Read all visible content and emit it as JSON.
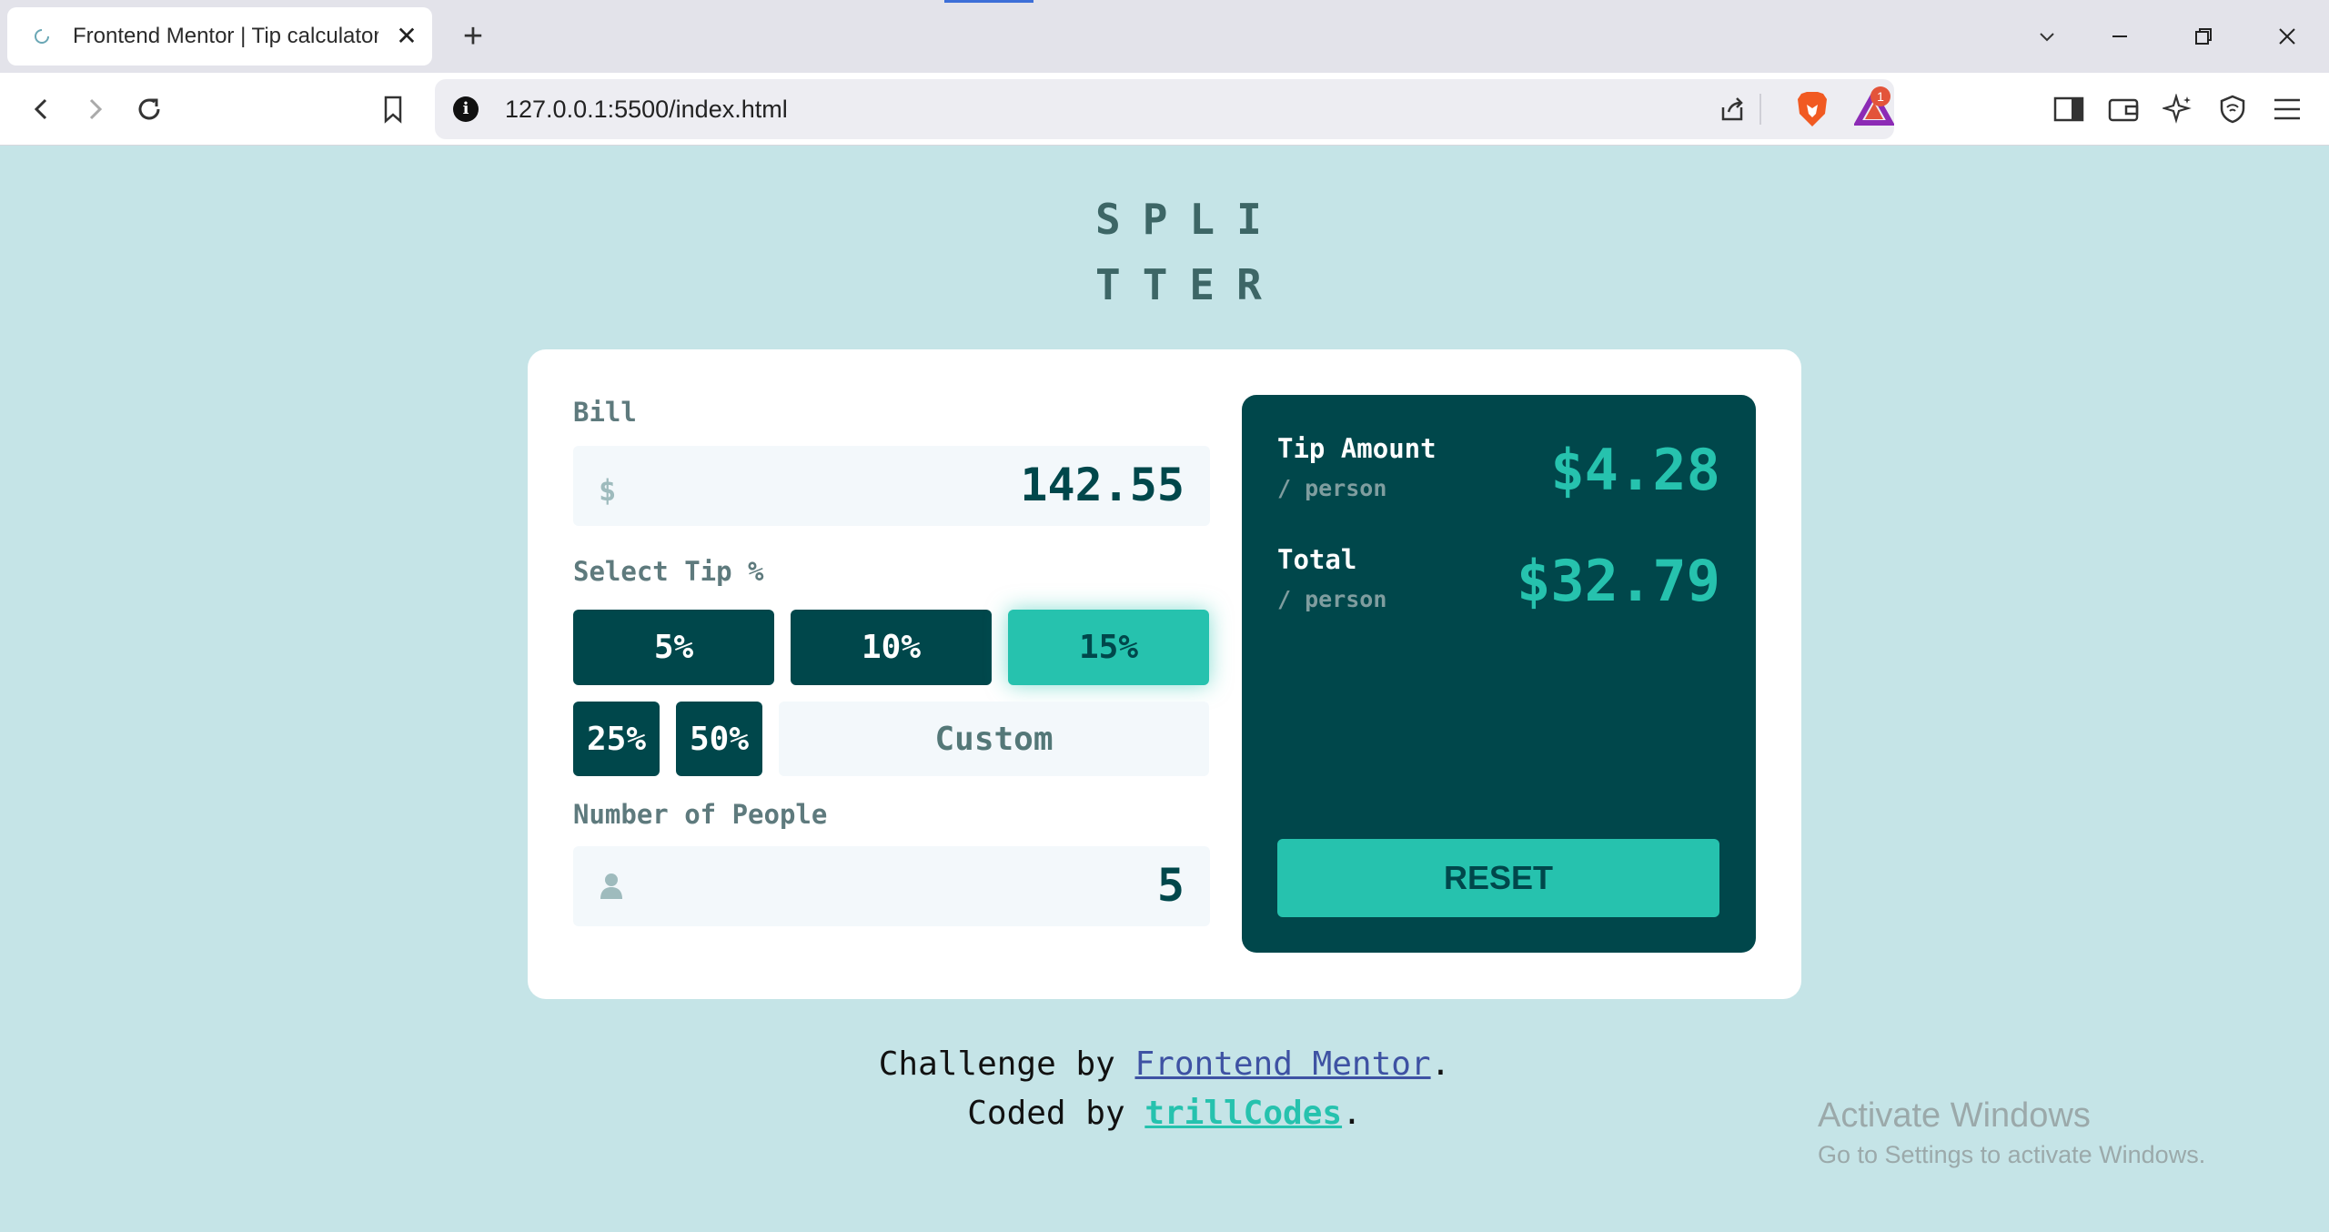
{
  "browser": {
    "tab_title": "Frontend Mentor | Tip calculator",
    "url": "127.0.0.1:5500/index.html",
    "rewards_badge": "1",
    "icons": [
      "back-icon",
      "forward-icon",
      "reload-icon",
      "bookmark-icon",
      "site-info-icon",
      "share-icon",
      "brave-shields-icon",
      "brave-rewards-icon",
      "sidebar-icon",
      "wallet-icon",
      "leo-ai-icon",
      "vpn-icon",
      "menu-icon",
      "tab-search-icon",
      "minimize-icon",
      "restore-icon",
      "close-icon"
    ]
  },
  "app": {
    "logo_line1": "SPLI",
    "logo_line2": "TTER",
    "bill_label": "Bill",
    "bill_icon": "$",
    "bill_value": "142.55",
    "tip_label": "Select Tip %",
    "tips": [
      "5%",
      "10%",
      "15%",
      "25%",
      "50%"
    ],
    "active_tip": "15%",
    "custom_placeholder": "Custom",
    "people_label": "Number of People",
    "people_value": "5",
    "tip_amount_label": "Tip Amount",
    "tip_amount_sub": "/ person",
    "tip_amount_value": "$4.28",
    "total_label": "Total",
    "total_sub": "/ person",
    "total_value": "$32.79",
    "reset_label": "RESET"
  },
  "attribution": {
    "line1_prefix": "Challenge by ",
    "line1_link": "Frontend Mentor",
    "line1_suffix": ".",
    "line2_prefix": "Coded by ",
    "line2_link": "trillCodes",
    "line2_suffix": "."
  },
  "watermark": {
    "title": "Activate Windows",
    "subtitle": "Go to Settings to activate Windows."
  },
  "colors": {
    "background": "#c5e4e7",
    "dark_cyan": "#00474b",
    "strong_cyan": "#26c2ae",
    "input_bg": "#f3f8fb"
  }
}
